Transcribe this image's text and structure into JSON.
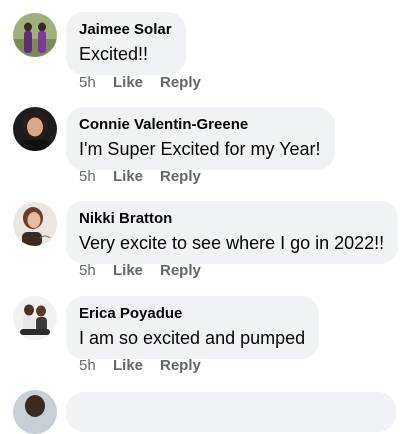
{
  "comments": [
    {
      "author": "Jaimee Solar",
      "text": "Excited!!",
      "time": "5h",
      "like_label": "Like",
      "reply_label": "Reply"
    },
    {
      "author": "Connie Valentin-Greene",
      "text": "I'm Super Excited for my Year!",
      "time": "5h",
      "like_label": "Like",
      "reply_label": "Reply"
    },
    {
      "author": "Nikki Bratton",
      "text": "Very excite to see where I go in 2022!!",
      "time": "5h",
      "like_label": "Like",
      "reply_label": "Reply"
    },
    {
      "author": "Erica Poyadue",
      "text": "I am so excited and pumped",
      "time": "5h",
      "like_label": "Like",
      "reply_label": "Reply"
    }
  ],
  "colors": {
    "bubble_bg": "#f0f2f5",
    "text": "#050505",
    "meta": "#65676b"
  }
}
